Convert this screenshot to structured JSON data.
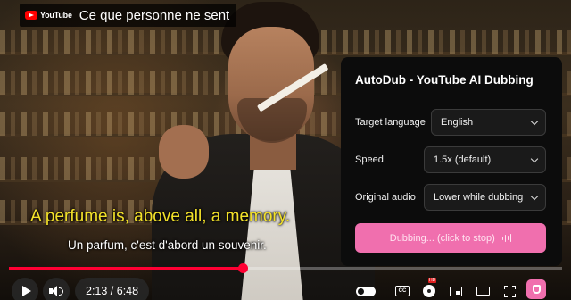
{
  "video": {
    "title": "Ce que personne ne sent",
    "brand": "YouTube",
    "subtitle_dubbed": "A perfume is, above all, a memory.",
    "subtitle_original": "Un parfum, c'est d'abord un souvenir."
  },
  "panel": {
    "title": "AutoDub - YouTube AI Dubbing",
    "target_language_label": "Target language",
    "target_language_value": "English",
    "speed_label": "Speed",
    "speed_value": "1.5x (default)",
    "original_audio_label": "Original audio",
    "original_audio_value": "Lower while dubbing",
    "dub_button_label": "Dubbing... (click to stop)"
  },
  "player": {
    "time": "2:13 / 6:48",
    "progress": 0.422,
    "cc_label": "CC",
    "settings_badge": "HD",
    "accent": "#ff0033",
    "extension_accent": "#f06fae"
  },
  "icons": [
    "youtube-logo",
    "play-icon",
    "volume-icon",
    "autoplay-toggle-icon",
    "subtitles-icon",
    "settings-icon",
    "miniplayer-icon",
    "theater-icon",
    "fullscreen-icon",
    "autodub-extension-icon",
    "audio-wave-icon",
    "chevron-down-icon"
  ]
}
